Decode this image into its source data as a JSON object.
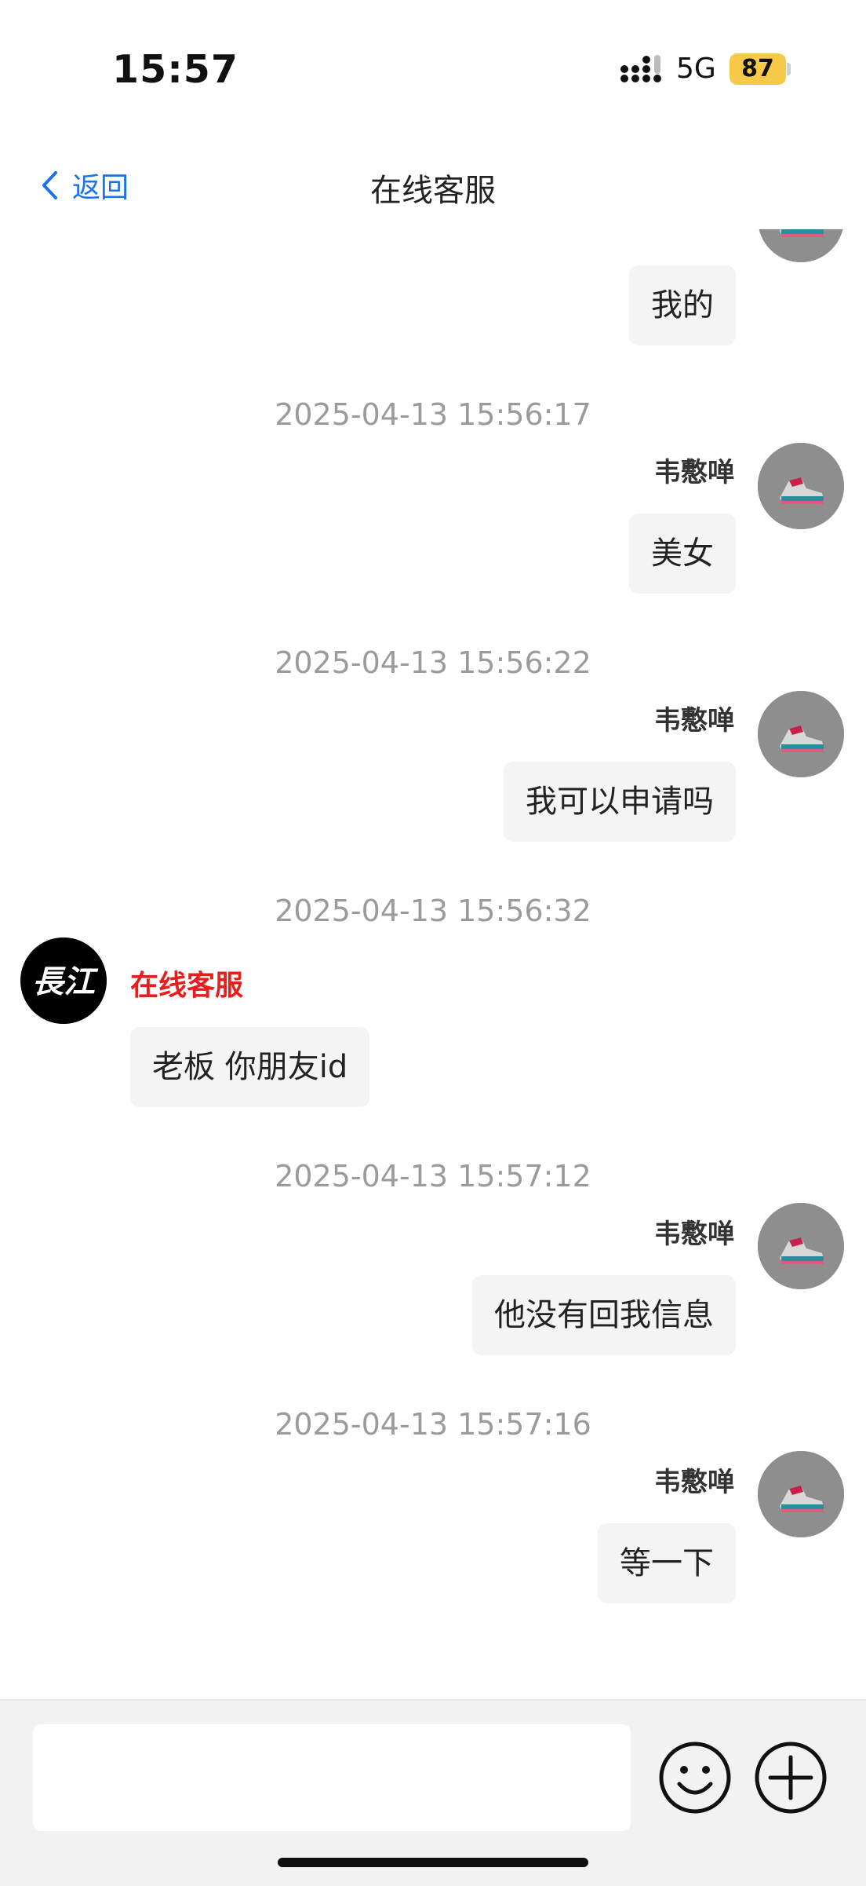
{
  "status_bar": {
    "time": "15:57",
    "network": "5G",
    "battery": "87"
  },
  "nav": {
    "back_label": "返回",
    "title": "在线客服"
  },
  "messages": [
    {
      "partial_text": "我的"
    },
    {
      "timestamp": "2025-04-13 15:56:17",
      "sender": "韦懯啴",
      "text": "美女"
    },
    {
      "timestamp": "2025-04-13 15:56:22",
      "sender": "韦懯啴",
      "text": "我可以申请吗"
    },
    {
      "timestamp": "2025-04-13 15:56:32",
      "sender": "在线客服",
      "text": "老板 你朋友id",
      "agent_logo_text": "長江"
    },
    {
      "timestamp": "2025-04-13 15:57:12",
      "sender": "韦懯啴",
      "text": "他没有回我信息"
    },
    {
      "timestamp": "2025-04-13 15:57:16",
      "sender": "韦懯啴",
      "text": "等一下"
    }
  ],
  "input": {
    "value": "",
    "placeholder": ""
  },
  "icons": {
    "emoji": "emoji-icon",
    "add": "plus-circle-icon",
    "back": "chevron-left-icon"
  },
  "colors": {
    "accent": "#1a73e8",
    "agent_name": "#e81e1e",
    "bubble": "#f4f4f4",
    "battery": "#f7c948"
  }
}
